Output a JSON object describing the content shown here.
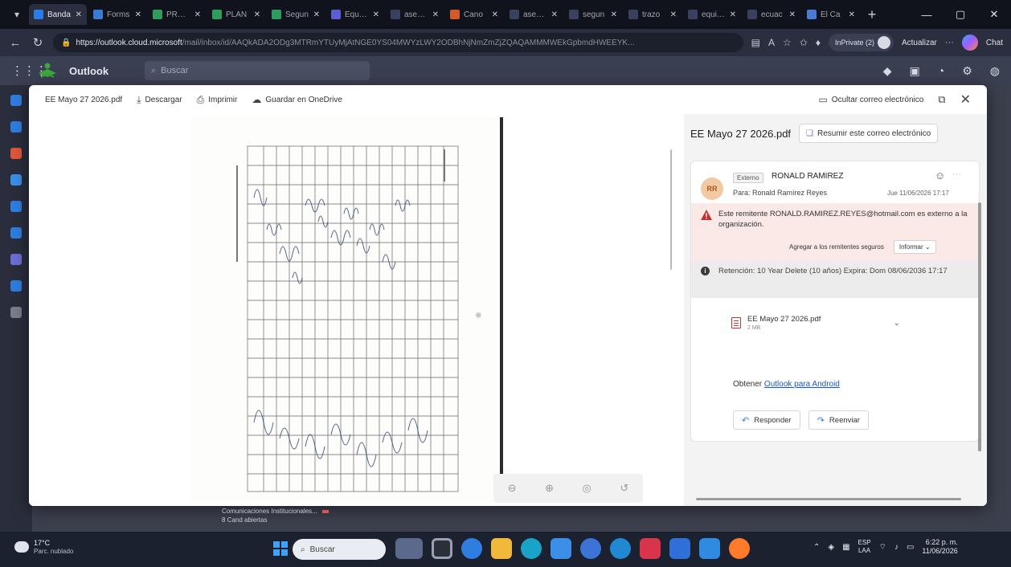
{
  "browser": {
    "tabs": [
      {
        "label": "Banda",
        "color": "#2d7be5",
        "active": true
      },
      {
        "label": "Forms",
        "color": "#3b7bd4"
      },
      {
        "label": "PREST",
        "color": "#2e9c5a"
      },
      {
        "label": "PLAN",
        "color": "#2e9c5a"
      },
      {
        "label": "Segun",
        "color": "#2e9c5a"
      },
      {
        "label": "Equipo",
        "color": "#5a5ed1"
      },
      {
        "label": "asesor",
        "color": "#3a4060"
      },
      {
        "label": "Cano",
        "color": "#d35a2a"
      },
      {
        "label": "asesor",
        "color": "#3a4060"
      },
      {
        "label": "segun",
        "color": "#3a4060"
      },
      {
        "label": "trazo",
        "color": "#3a4060"
      },
      {
        "label": "equipo",
        "color": "#3a4060"
      },
      {
        "label": "ecuac",
        "color": "#3a4060"
      },
      {
        "label": "El Ca",
        "color": "#4a7ad1"
      }
    ],
    "url_host": "https://outlook.cloud.microsoft",
    "url_path": "/mail/inbox/id/AAQkADA2ODg3MTRmYTUyMjAtNGE0YS04MWYzLWY2ODBhNjNmZmZjZQAQAMMMWEkGpbmdHWEEYK...",
    "profile_label": "InPrivate (2)",
    "update_label": "Actualizar",
    "copilot_label": "Chat"
  },
  "outlook": {
    "app_name": "Outlook",
    "search_placeholder": "Buscar"
  },
  "viewer": {
    "file_name": "EE Mayo 27 2026.pdf",
    "download_label": "Descargar",
    "print_label": "Imprimir",
    "save_onedrive_label": "Guardar en OneDrive",
    "hide_email_label": "Ocultar correo electrónico"
  },
  "message": {
    "subject": "EE Mayo 27 2026.pdf",
    "summarize_label": "Resumir este correo electrónico",
    "sender_initials": "RR",
    "external_tag": "Externo",
    "sender_name": "RONALD RAMIREZ",
    "to_line": "Para:  Ronald Ramírez Reyes",
    "date": "Jue 11/06/2026 17:17",
    "warning_text": "Este remitente RONALD.RAMIREZ.REYES@hotmail.com es externo a la organización.",
    "add_safe_label": "Agregar a los remitentes seguros",
    "inform_label": "Informar",
    "retention_text": "Retención: 10 Year Delete (10 años) Expira: Dom 08/06/2036 17:17",
    "attachment_name": "EE Mayo 27 2026.pdf",
    "attachment_size": "2 MB",
    "get_app_prefix": "Obtener ",
    "get_app_link": "Outlook para Android",
    "reply_label": "Responder",
    "forward_label": "Reenviar"
  },
  "mailbox_peek": {
    "row1": "Comunicaciones Institucionales...",
    "row2": "8 Cand abiertas"
  },
  "taskbar": {
    "weather_temp": "17°C",
    "weather_desc": "Parc. nublado",
    "search_placeholder": "Buscar",
    "lang_top": "ESP",
    "lang_bottom": "LAA",
    "time": "6:22 p. m.",
    "date": "11/06/2026"
  }
}
